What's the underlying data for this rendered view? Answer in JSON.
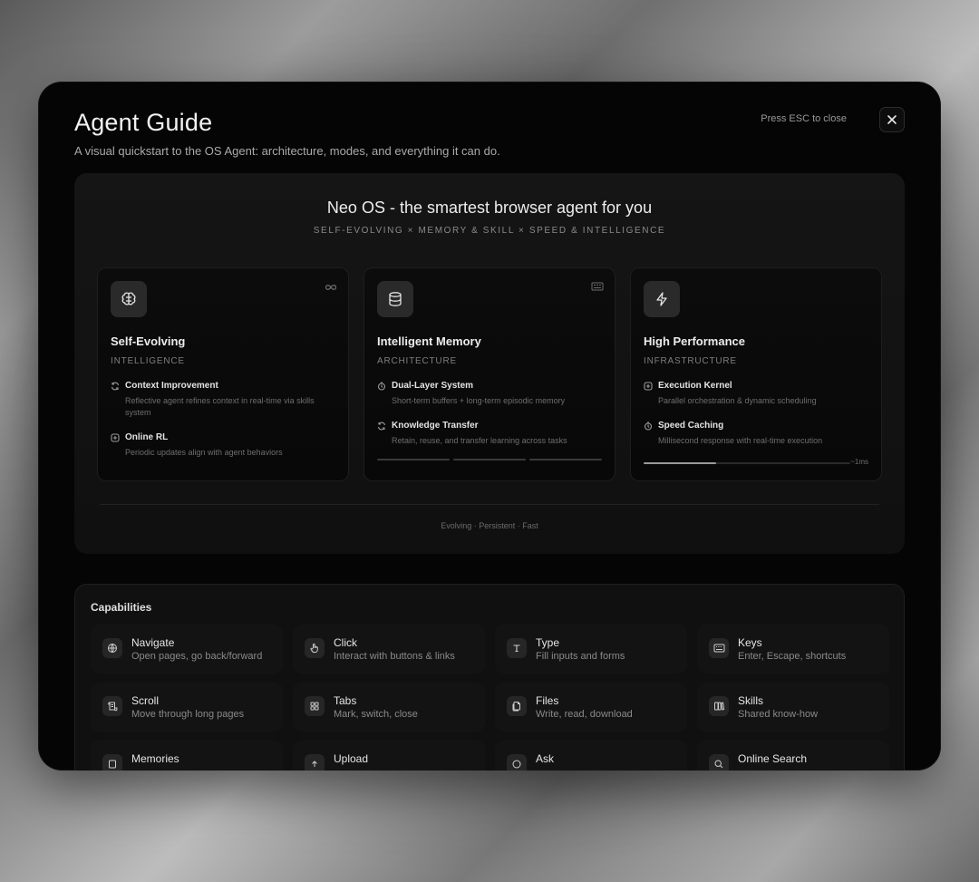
{
  "modal": {
    "title": "Agent Guide",
    "subtitle": "A visual quickstart to the OS Agent: architecture, modes, and everything it can do.",
    "esc_hint": "Press ESC to close",
    "close_icon": "close-icon"
  },
  "hero": {
    "title": "Neo OS - the smartest browser agent for you",
    "tagline": "SELF-EVOLVING × MEMORY & SKILL × SPEED & INTELLIGENCE",
    "footer": "Evolving · Persistent · Fast",
    "cards": [
      {
        "icon": "brain-icon",
        "corner_icon": "infinity-icon",
        "title": "Self-Evolving",
        "subtitle": "INTELLIGENCE",
        "items": [
          {
            "icon": "refresh-icon",
            "title": "Context Improvement",
            "desc": "Reflective agent refines context in real-time via skills system"
          },
          {
            "icon": "plus-square-icon",
            "title": "Online RL",
            "desc": "Periodic updates align with agent behaviors"
          }
        ]
      },
      {
        "icon": "database-icon",
        "corner_icon": "memory-chip-icon",
        "title": "Intelligent Memory",
        "subtitle": "ARCHITECTURE",
        "items": [
          {
            "icon": "timer-icon",
            "title": "Dual-Layer System",
            "desc": "Short-term buffers + long-term episodic memory"
          },
          {
            "icon": "refresh-icon",
            "title": "Knowledge Transfer",
            "desc": "Retain, reuse, and transfer learning across tasks"
          }
        ]
      },
      {
        "icon": "lightning-icon",
        "corner_icon": "",
        "title": "High Performance",
        "subtitle": "INFRASTRUCTURE",
        "items": [
          {
            "icon": "plus-square-icon",
            "title": "Execution Kernel",
            "desc": "Parallel orchestration & dynamic scheduling"
          },
          {
            "icon": "timer-icon",
            "title": "Speed Caching",
            "desc": "Millisecond response with real-time execution"
          }
        ],
        "progress_fraction": 0.35,
        "progress_label": "~1ms"
      }
    ]
  },
  "capabilities": {
    "heading": "Capabilities",
    "items": [
      {
        "icon": "globe-icon",
        "title": "Navigate",
        "desc": "Open pages, go back/forward"
      },
      {
        "icon": "pointer-icon",
        "title": "Click",
        "desc": "Interact with buttons & links"
      },
      {
        "icon": "text-icon",
        "title": "Type",
        "desc": "Fill inputs and forms"
      },
      {
        "icon": "keyboard-icon",
        "title": "Keys",
        "desc": "Enter, Escape, shortcuts"
      },
      {
        "icon": "scroll-icon",
        "title": "Scroll",
        "desc": "Move through long pages"
      },
      {
        "icon": "tabs-icon",
        "title": "Tabs",
        "desc": "Mark, switch, close"
      },
      {
        "icon": "file-icon",
        "title": "Files",
        "desc": "Write, read, download"
      },
      {
        "icon": "book-icon",
        "title": "Skills",
        "desc": "Shared know-how"
      },
      {
        "icon": "memory-icon",
        "title": "Memories",
        "desc": ""
      },
      {
        "icon": "upload-icon",
        "title": "Upload",
        "desc": ""
      },
      {
        "icon": "ask-icon",
        "title": "Ask",
        "desc": ""
      },
      {
        "icon": "search-icon",
        "title": "Online Search",
        "desc": ""
      }
    ]
  }
}
